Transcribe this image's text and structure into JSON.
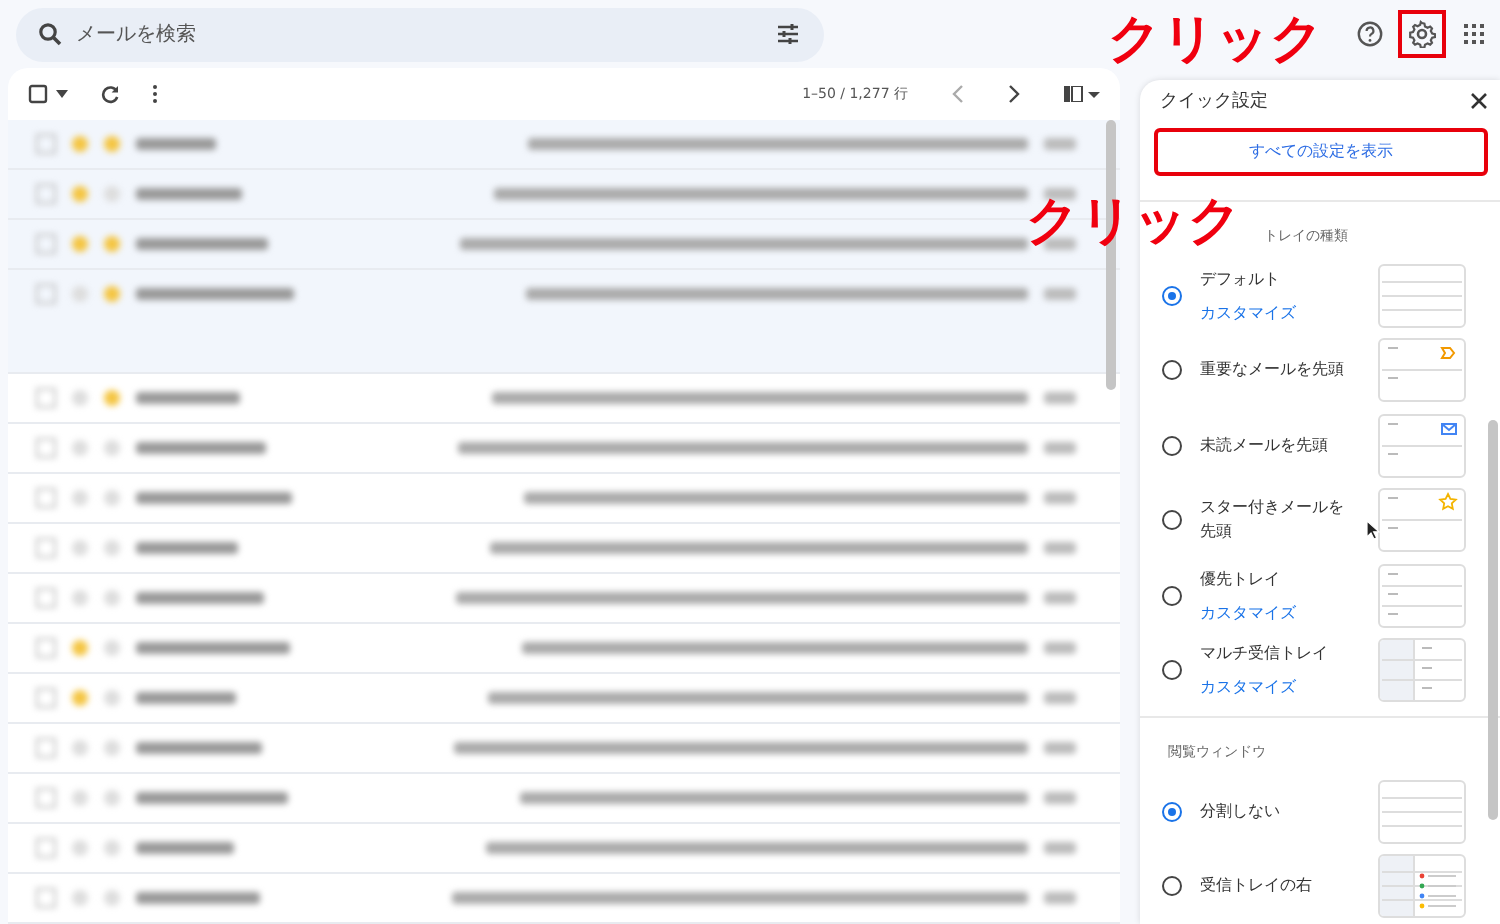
{
  "search": {
    "placeholder": "メールを検索"
  },
  "header_icons": [
    {
      "kind": "help",
      "highlighted": false
    },
    {
      "kind": "settings",
      "highlighted": true
    },
    {
      "kind": "apps",
      "highlighted": false
    }
  ],
  "toolbar": {
    "page_range": "1–50 / 1,277 行"
  },
  "quick_settings": {
    "title": "クイック設定",
    "all_settings_button": {
      "label": "すべての設定を表示",
      "highlighted": true
    },
    "sections": [
      {
        "heading": "トレイの種類",
        "options": [
          {
            "label": "デフォルト",
            "link": "カスタマイズ",
            "selected": true,
            "kind": "default"
          },
          {
            "label": "重要なメールを先頭",
            "selected": false,
            "kind": "important"
          },
          {
            "label": "未読メールを先頭",
            "selected": false,
            "kind": "unread"
          },
          {
            "label": "スター付きメールを先頭",
            "selected": false,
            "kind": "starred"
          },
          {
            "label": "優先トレイ",
            "link": "カスタマイズ",
            "selected": false,
            "kind": "priority"
          },
          {
            "label": "マルチ受信トレイ",
            "link": "カスタマイズ",
            "selected": false,
            "kind": "multi"
          }
        ]
      },
      {
        "heading": "閲覧ウィンドウ",
        "options": [
          {
            "label": "分割しない",
            "selected": true,
            "kind": "default"
          },
          {
            "label": "受信トレイの右",
            "selected": false,
            "kind": "split"
          }
        ]
      }
    ]
  },
  "annotations": [
    {
      "text": "クリック"
    },
    {
      "text": "クリック"
    }
  ]
}
